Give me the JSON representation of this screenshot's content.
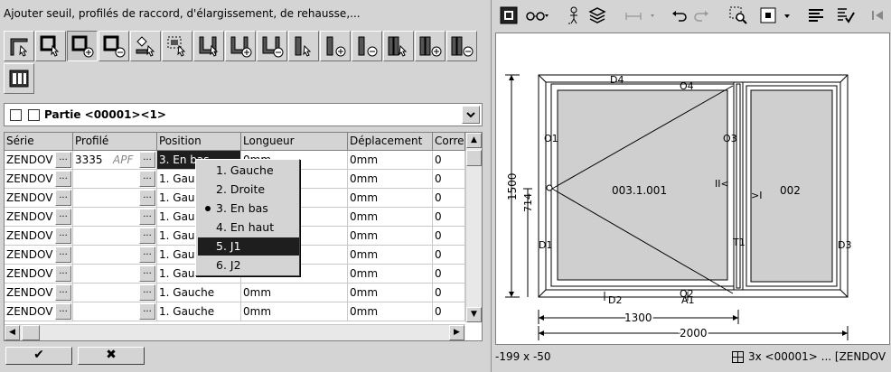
{
  "left_panel": {
    "title": "Ajouter seuil, profilés de raccord, d'élargissement, de rehausse,...",
    "toolbar_icons": [
      "profile-select-icon",
      "frame-select-icon",
      "frame-add-icon",
      "frame-remove-icon",
      "frame-edit-icon",
      "frame-dotted-icon",
      "sill-select-icon",
      "sill-add-icon",
      "sill-remove-icon",
      "jamb-select-icon",
      "jamb-add-icon",
      "jamb-remove-icon",
      "double-jamb-select-icon",
      "double-jamb-add-icon",
      "double-jamb-remove-icon",
      "component-icon"
    ],
    "part_combo": {
      "label": "Partie <00001><1>"
    },
    "grid": {
      "headers": [
        "Série",
        "Profilé",
        "Position",
        "Longueur",
        "Déplacement",
        "Corre"
      ],
      "rows": [
        {
          "serie": "ZENDOV",
          "profile": "3335",
          "profile_note": "APF",
          "position": "3. En bas",
          "length": "0mm",
          "offset": "0mm",
          "corr": "0"
        },
        {
          "serie": "ZENDOV",
          "profile": "",
          "profile_note": "",
          "position": "1. Gau",
          "length": "",
          "offset": "0mm",
          "corr": "0"
        },
        {
          "serie": "ZENDOV",
          "profile": "",
          "profile_note": "",
          "position": "1. Gau",
          "length": "",
          "offset": "0mm",
          "corr": "0"
        },
        {
          "serie": "ZENDOV",
          "profile": "",
          "profile_note": "",
          "position": "1. Gau",
          "length": "",
          "offset": "0mm",
          "corr": "0"
        },
        {
          "serie": "ZENDOV",
          "profile": "",
          "profile_note": "",
          "position": "1. Gau",
          "length": "",
          "offset": "0mm",
          "corr": "0"
        },
        {
          "serie": "ZENDOV",
          "profile": "",
          "profile_note": "",
          "position": "1. Gau",
          "length": "",
          "offset": "0mm",
          "corr": "0"
        },
        {
          "serie": "ZENDOV",
          "profile": "",
          "profile_note": "",
          "position": "1. Gau",
          "length": "",
          "offset": "0mm",
          "corr": "0"
        },
        {
          "serie": "ZENDOV",
          "profile": "",
          "profile_note": "",
          "position": "1. Gauche",
          "length": "0mm",
          "offset": "0mm",
          "corr": "0"
        },
        {
          "serie": "ZENDOV",
          "profile": "",
          "profile_note": "",
          "position": "1. Gauche",
          "length": "0mm",
          "offset": "0mm",
          "corr": "0"
        }
      ],
      "ellipsis_label": "..."
    },
    "position_dropdown": {
      "options": [
        "1. Gauche",
        "2. Droite",
        "3. En bas",
        "4. En haut",
        "5. J1",
        "6. J2"
      ],
      "selected_option": "3. En bas",
      "highlighted_option": "5. J1"
    },
    "buttons": {
      "ok": "✔",
      "cancel": "✖"
    }
  },
  "right_panel": {
    "toolbar_icons": [
      "view-mode-icon",
      "glasses-icon",
      "person-icon",
      "layers-icon",
      "dimension-icon",
      "undo-icon",
      "redo-icon",
      "zoom-region-icon",
      "display-mode-icon",
      "align-text-icon",
      "properties-check-icon",
      "go-end-icon"
    ],
    "drawing": {
      "labels": {
        "d4": "D4",
        "o4": "O4",
        "o1": "O1",
        "o3": "O3",
        "d1": "D1",
        "t1": "T1",
        "d3": "D3",
        "o2": "O2",
        "d2": "D2",
        "a1": "A1",
        "sash_id": "003.1.001",
        "panel_id": "002",
        "open_left": "II<",
        "open_right": ">I"
      },
      "dimensions": {
        "total_height": "1500",
        "handle_height": "714",
        "sash_width": "1300",
        "total_width": "2000"
      }
    },
    "status": {
      "coordinates": "-199 x -50",
      "part": "3x <00001> ... [ZENDOV"
    }
  }
}
